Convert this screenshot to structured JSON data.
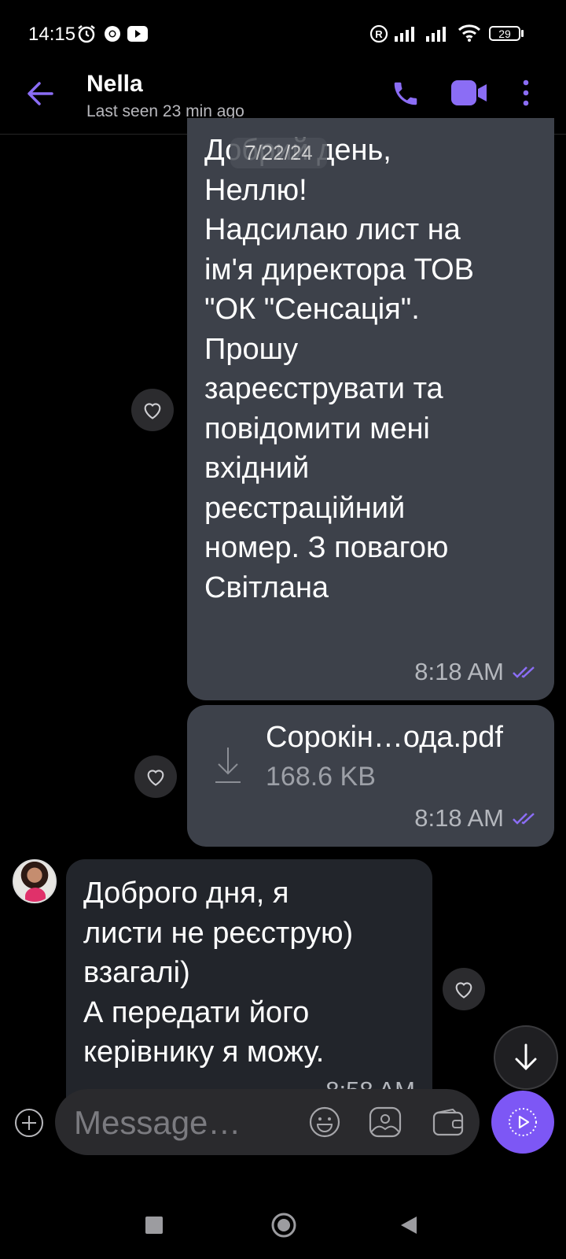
{
  "status_bar": {
    "time": "14:15",
    "battery": "29"
  },
  "header": {
    "contact_name": "Nella",
    "last_seen": "Last seen 23 min ago"
  },
  "date_chip": "7/22/24",
  "messages": [
    {
      "direction": "outgoing",
      "text": "Добрий день,\nНеллю!\nНадсилаю лист на\nім'я директора ТОВ\n\"ОК \"Сенсація\".\nПрошу\nзареєструвати та\nповідомити мені\nвхідний\nреєстраційний\nномер. З повагою\nСвітлана",
      "time": "8:18 AM"
    },
    {
      "direction": "outgoing",
      "file_name": "Сорокін…ода.pdf",
      "file_size": "168.6 KB",
      "time": "8:18 AM"
    },
    {
      "direction": "incoming",
      "text": "Доброго дня, я\nлисти не реєструю)\nвзагалі)\nА передати його\nкерівнику я можу.",
      "time": "8:58 AM"
    }
  ],
  "composer": {
    "placeholder": "Message…"
  },
  "colors": {
    "accent": "#7d57f5",
    "outgoing_bubble": "#3d414a",
    "incoming_bubble": "#22252b"
  },
  "icons": [
    "alarm-icon",
    "chrome-icon",
    "youtube-icon",
    "roaming-icon",
    "signal-icon",
    "wifi-icon",
    "battery-icon",
    "back-arrow-icon",
    "phone-icon",
    "video-icon",
    "more-icon",
    "heart-icon",
    "download-icon",
    "add-icon",
    "emoji-icon",
    "gallery-icon",
    "wallet-icon",
    "send-icon",
    "arrow-down-icon",
    "nav-square-icon",
    "nav-circle-icon",
    "nav-back-icon"
  ]
}
